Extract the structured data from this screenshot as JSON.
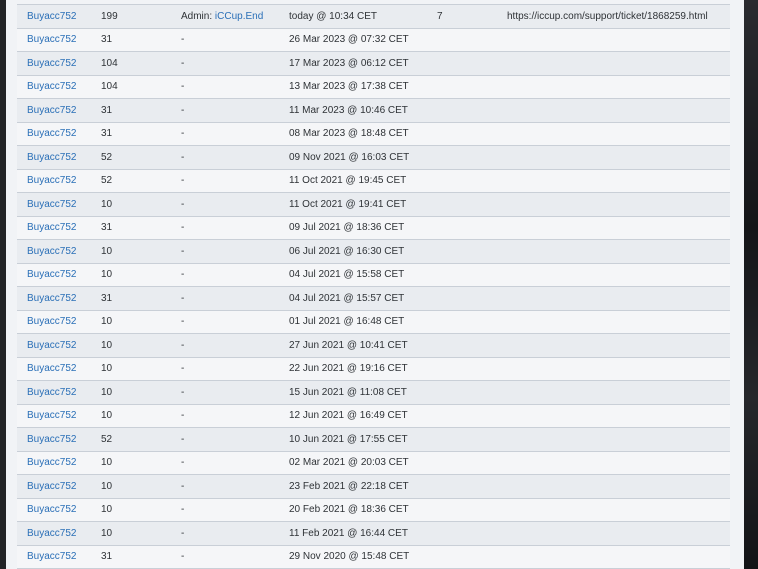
{
  "log": {
    "rows": [
      {
        "user": "Buyacc752",
        "value": "199",
        "by_prefix": "Admin: ",
        "by_link": "iCCup.End",
        "date": "today @ 10:34 CET",
        "count": "7",
        "link": "https://iccup.com/support/ticket/1868259.html"
      },
      {
        "user": "Buyacc752",
        "value": "31",
        "by_prefix": "-",
        "by_link": "",
        "date": "26 Mar 2023 @ 07:32 CET",
        "count": "",
        "link": ""
      },
      {
        "user": "Buyacc752",
        "value": "104",
        "by_prefix": "-",
        "by_link": "",
        "date": "17 Mar 2023 @ 06:12 CET",
        "count": "",
        "link": ""
      },
      {
        "user": "Buyacc752",
        "value": "104",
        "by_prefix": "-",
        "by_link": "",
        "date": "13 Mar 2023 @ 17:38 CET",
        "count": "",
        "link": ""
      },
      {
        "user": "Buyacc752",
        "value": "31",
        "by_prefix": "-",
        "by_link": "",
        "date": "11 Mar 2023 @ 10:46 CET",
        "count": "",
        "link": ""
      },
      {
        "user": "Buyacc752",
        "value": "31",
        "by_prefix": "-",
        "by_link": "",
        "date": "08 Mar 2023 @ 18:48 CET",
        "count": "",
        "link": ""
      },
      {
        "user": "Buyacc752",
        "value": "52",
        "by_prefix": "-",
        "by_link": "",
        "date": "09 Nov 2021 @ 16:03 CET",
        "count": "",
        "link": ""
      },
      {
        "user": "Buyacc752",
        "value": "52",
        "by_prefix": "-",
        "by_link": "",
        "date": "11 Oct 2021 @ 19:45 CET",
        "count": "",
        "link": ""
      },
      {
        "user": "Buyacc752",
        "value": "10",
        "by_prefix": "-",
        "by_link": "",
        "date": "11 Oct 2021 @ 19:41 CET",
        "count": "",
        "link": ""
      },
      {
        "user": "Buyacc752",
        "value": "31",
        "by_prefix": "-",
        "by_link": "",
        "date": "09 Jul 2021 @ 18:36 CET",
        "count": "",
        "link": ""
      },
      {
        "user": "Buyacc752",
        "value": "10",
        "by_prefix": "-",
        "by_link": "",
        "date": "06 Jul 2021 @ 16:30 CET",
        "count": "",
        "link": ""
      },
      {
        "user": "Buyacc752",
        "value": "10",
        "by_prefix": "-",
        "by_link": "",
        "date": "04 Jul 2021 @ 15:58 CET",
        "count": "",
        "link": ""
      },
      {
        "user": "Buyacc752",
        "value": "31",
        "by_prefix": "-",
        "by_link": "",
        "date": "04 Jul 2021 @ 15:57 CET",
        "count": "",
        "link": ""
      },
      {
        "user": "Buyacc752",
        "value": "10",
        "by_prefix": "-",
        "by_link": "",
        "date": "01 Jul 2021 @ 16:48 CET",
        "count": "",
        "link": ""
      },
      {
        "user": "Buyacc752",
        "value": "10",
        "by_prefix": "-",
        "by_link": "",
        "date": "27 Jun 2021 @ 10:41 CET",
        "count": "",
        "link": ""
      },
      {
        "user": "Buyacc752",
        "value": "10",
        "by_prefix": "-",
        "by_link": "",
        "date": "22 Jun 2021 @ 19:16 CET",
        "count": "",
        "link": ""
      },
      {
        "user": "Buyacc752",
        "value": "10",
        "by_prefix": "-",
        "by_link": "",
        "date": "15 Jun 2021 @ 11:08 CET",
        "count": "",
        "link": ""
      },
      {
        "user": "Buyacc752",
        "value": "10",
        "by_prefix": "-",
        "by_link": "",
        "date": "12 Jun 2021 @ 16:49 CET",
        "count": "",
        "link": ""
      },
      {
        "user": "Buyacc752",
        "value": "52",
        "by_prefix": "-",
        "by_link": "",
        "date": "10 Jun 2021 @ 17:55 CET",
        "count": "",
        "link": ""
      },
      {
        "user": "Buyacc752",
        "value": "10",
        "by_prefix": "-",
        "by_link": "",
        "date": "02 Mar 2021 @ 20:03 CET",
        "count": "",
        "link": ""
      },
      {
        "user": "Buyacc752",
        "value": "10",
        "by_prefix": "-",
        "by_link": "",
        "date": "23 Feb 2021 @ 22:18 CET",
        "count": "",
        "link": ""
      },
      {
        "user": "Buyacc752",
        "value": "10",
        "by_prefix": "-",
        "by_link": "",
        "date": "20 Feb 2021 @ 18:36 CET",
        "count": "",
        "link": ""
      },
      {
        "user": "Buyacc752",
        "value": "10",
        "by_prefix": "-",
        "by_link": "",
        "date": "11 Feb 2021 @ 16:44 CET",
        "count": "",
        "link": ""
      },
      {
        "user": "Buyacc752",
        "value": "31",
        "by_prefix": "-",
        "by_link": "",
        "date": "29 Nov 2020 @ 15:48 CET",
        "count": "",
        "link": ""
      }
    ]
  },
  "colors": {
    "link": "#2a6fb7",
    "text": "#2e3236",
    "row_odd": "#e9ecf0",
    "row_even": "#f5f6f8",
    "border": "#c9cfd7",
    "outer_bg": "#1a1b1e"
  }
}
